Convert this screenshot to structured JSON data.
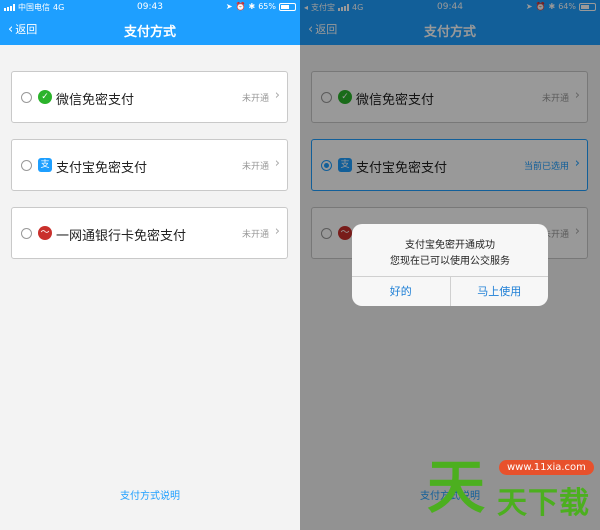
{
  "left": {
    "status": {
      "carrier": "中国电信",
      "network": "4G",
      "time": "09:43",
      "battery": "65%",
      "battery_level": 0.65
    },
    "nav": {
      "back_label": "返回",
      "title": "支付方式"
    },
    "options": [
      {
        "label": "微信免密支付",
        "status": "未开通",
        "icon": "wechat-icon",
        "selected": false
      },
      {
        "label": "支付宝免密支付",
        "status": "未开通",
        "icon": "alipay-icon",
        "selected": false
      },
      {
        "label": "一网通银行卡免密支付",
        "status": "未开通",
        "icon": "cmb-bank-icon",
        "selected": false
      }
    ],
    "explain_link": "支付方式说明"
  },
  "right": {
    "status": {
      "carrier": "支付宝",
      "network": "4G",
      "time": "09:44",
      "battery": "64%",
      "battery_level": 0.64
    },
    "nav": {
      "back_label": "返回",
      "title": "支付方式"
    },
    "options": [
      {
        "label": "微信免密支付",
        "status": "未开通",
        "icon": "wechat-icon",
        "selected": false
      },
      {
        "label": "支付宝免密支付",
        "status": "当前已选用",
        "icon": "alipay-icon",
        "selected": true
      },
      {
        "label": "",
        "status": "未开通",
        "icon": "cmb-bank-icon",
        "selected": false
      }
    ],
    "explain_link": "支付方式说明",
    "dialog": {
      "line1": "支付宝免密开通成功",
      "line2": "您现在已可以使用公交服务",
      "cancel_label": "好的",
      "confirm_label": "马上使用"
    }
  },
  "watermark": {
    "big_char": "天",
    "chars": "天下载",
    "url": "www.11xia.com"
  },
  "colors": {
    "accent": "#1e9fff",
    "wechat": "#2bb32b",
    "bank": "#c9302c",
    "watermark": "#4caf1f"
  }
}
